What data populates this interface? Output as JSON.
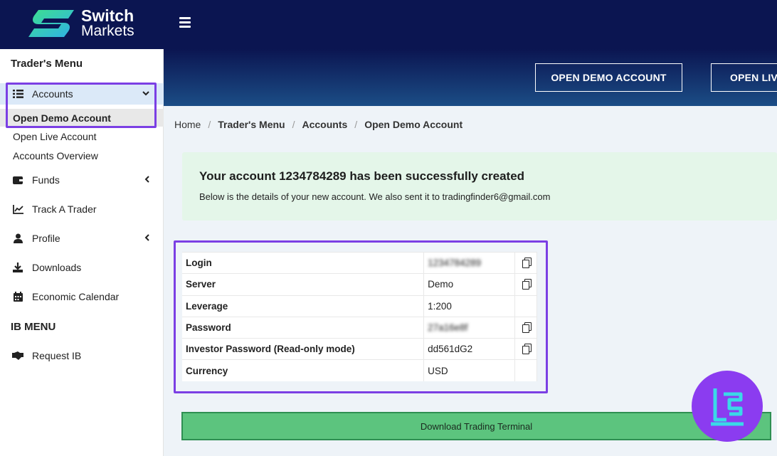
{
  "brand": {
    "line1": "Switch",
    "line2": "Markets"
  },
  "sidebar": {
    "traders_menu_heading": "Trader's Menu",
    "accounts_label": "Accounts",
    "sub_items": [
      "Open Demo Account",
      "Open Live Account",
      "Accounts Overview"
    ],
    "funds_label": "Funds",
    "track_label": "Track A Trader",
    "profile_label": "Profile",
    "downloads_label": "Downloads",
    "calendar_label": "Economic Calendar",
    "ib_heading": "IB MENU",
    "request_ib_label": "Request IB"
  },
  "banner": {
    "demo_button": "OPEN DEMO ACCOUNT",
    "live_button": "OPEN LIVE ACCOUNT"
  },
  "breadcrumb": {
    "home": "Home",
    "traders_menu": "Trader's Menu",
    "accounts": "Accounts",
    "current": "Open Demo Account"
  },
  "alert": {
    "title": "Your account 1234784289 has been successfully created",
    "subtitle": "Below is the details of your new account. We also sent it to tradingfinder6@gmail.com"
  },
  "details": {
    "rows": [
      {
        "label": "Login",
        "value": "1234784289",
        "blurred": true,
        "copy": true
      },
      {
        "label": "Server",
        "value": "Demo",
        "blurred": false,
        "copy": true
      },
      {
        "label": "Leverage",
        "value": "1:200",
        "blurred": false,
        "copy": false
      },
      {
        "label": "Password",
        "value": "27a16e8f",
        "blurred": true,
        "copy": true
      },
      {
        "label": "Investor Password (Read-only mode)",
        "value": "dd561dG2",
        "blurred": false,
        "copy": true
      },
      {
        "label": "Currency",
        "value": "USD",
        "blurred": false,
        "copy": false
      }
    ]
  },
  "download_button": "Download Trading Terminal",
  "colors": {
    "topbar": "#0b1551",
    "accent_highlight": "#7b3fe4",
    "success_bg": "#e4f6e9",
    "download_green": "#5cc47e"
  }
}
